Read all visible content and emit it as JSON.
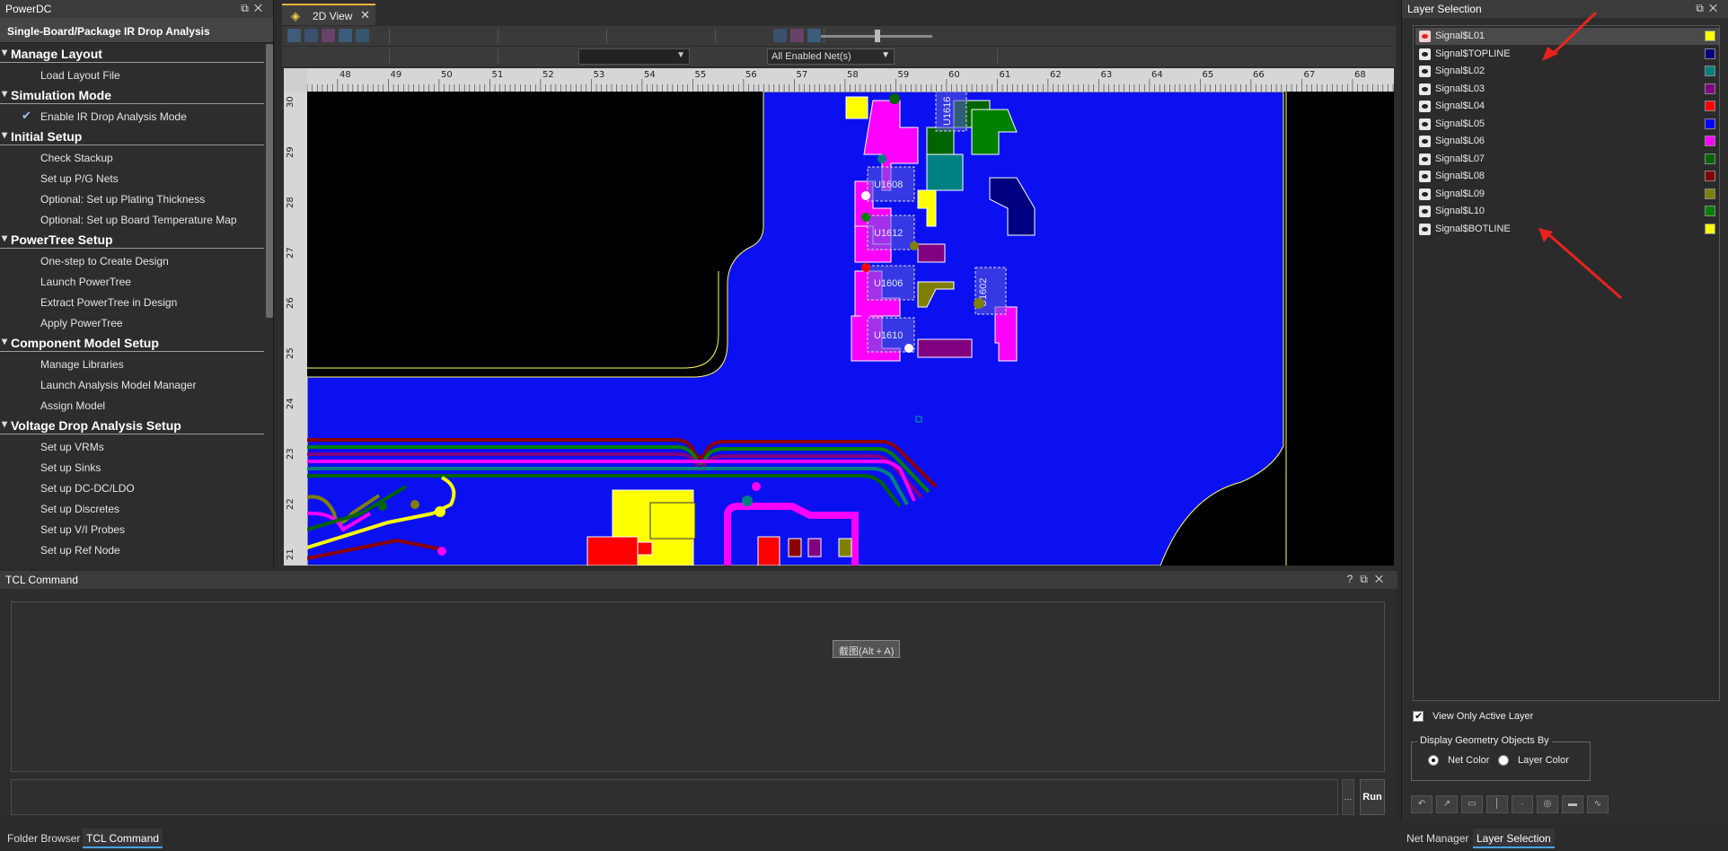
{
  "app": {
    "title": "PowerDC"
  },
  "workflow": {
    "header": "Single-Board/Package IR Drop Analysis",
    "sections": [
      {
        "title": "Manage Layout",
        "items": [
          "Load Layout File"
        ]
      },
      {
        "title": "Simulation Mode",
        "items": [
          "Enable IR Drop Analysis Mode"
        ]
      },
      {
        "title": "Initial Setup",
        "items": [
          "Check Stackup",
          "Set up P/G Nets",
          "Optional: Set up Plating Thickness",
          "Optional: Set up Board Temperature Map"
        ]
      },
      {
        "title": "PowerTree Setup",
        "items": [
          "One-step to Create Design",
          "Launch PowerTree",
          "Extract PowerTree in Design",
          "Apply PowerTree"
        ]
      },
      {
        "title": "Component Model Setup",
        "items": [
          "Manage Libraries",
          "Launch Analysis Model Manager",
          "Assign Model"
        ]
      },
      {
        "title": "Voltage Drop Analysis Setup",
        "items": [
          "Set up VRMs",
          "Set up Sinks",
          "Set up DC-DC/LDO",
          "Set up Discretes",
          "Set up V/I Probes",
          "Set up Ref Node"
        ]
      }
    ]
  },
  "view": {
    "tab_label": "2D View",
    "net_filter": "All Enabled Net(s)",
    "ruler_h": [
      "48",
      "49",
      "50",
      "51",
      "52",
      "53",
      "54",
      "55",
      "56",
      "57",
      "58",
      "59",
      "60",
      "61",
      "62",
      "63",
      "64",
      "65",
      "66",
      "67",
      "68"
    ],
    "ruler_v": [
      "30",
      "29",
      "28",
      "27",
      "26",
      "25",
      "24",
      "23",
      "22",
      "21"
    ],
    "components": [
      "U1608",
      "U1612",
      "U1606",
      "U1610",
      "U1602",
      "U1616"
    ]
  },
  "tcl": {
    "title": "TCL Command",
    "tooltip": "截图(Alt + A)",
    "run_label": "Run",
    "dots": "..."
  },
  "bottom_tabs_left": [
    "Folder Browser",
    "TCL Command"
  ],
  "bottom_tabs_right": [
    "Net Manager",
    "Layer Selection"
  ],
  "layers": {
    "title": "Layer Selection",
    "items": [
      {
        "name": "Signal$L01",
        "color": "#ffff00"
      },
      {
        "name": "Signal$TOPLINE",
        "color": "#000080"
      },
      {
        "name": "Signal$L02",
        "color": "#008080"
      },
      {
        "name": "Signal$L03",
        "color": "#800080"
      },
      {
        "name": "Signal$L04",
        "color": "#ff0000"
      },
      {
        "name": "Signal$L05",
        "color": "#0000ff"
      },
      {
        "name": "Signal$L06",
        "color": "#ff00ff"
      },
      {
        "name": "Signal$L07",
        "color": "#006400"
      },
      {
        "name": "Signal$L08",
        "color": "#800000"
      },
      {
        "name": "Signal$L09",
        "color": "#808000"
      },
      {
        "name": "Signal$L10",
        "color": "#008000"
      },
      {
        "name": "Signal$BOTLINE",
        "color": "#ffff00"
      }
    ],
    "view_only_label": "View Only Active Layer",
    "geom_legend": "Display Geometry Objects By",
    "net_color_label": "Net Color",
    "layer_color_label": "Layer Color"
  }
}
